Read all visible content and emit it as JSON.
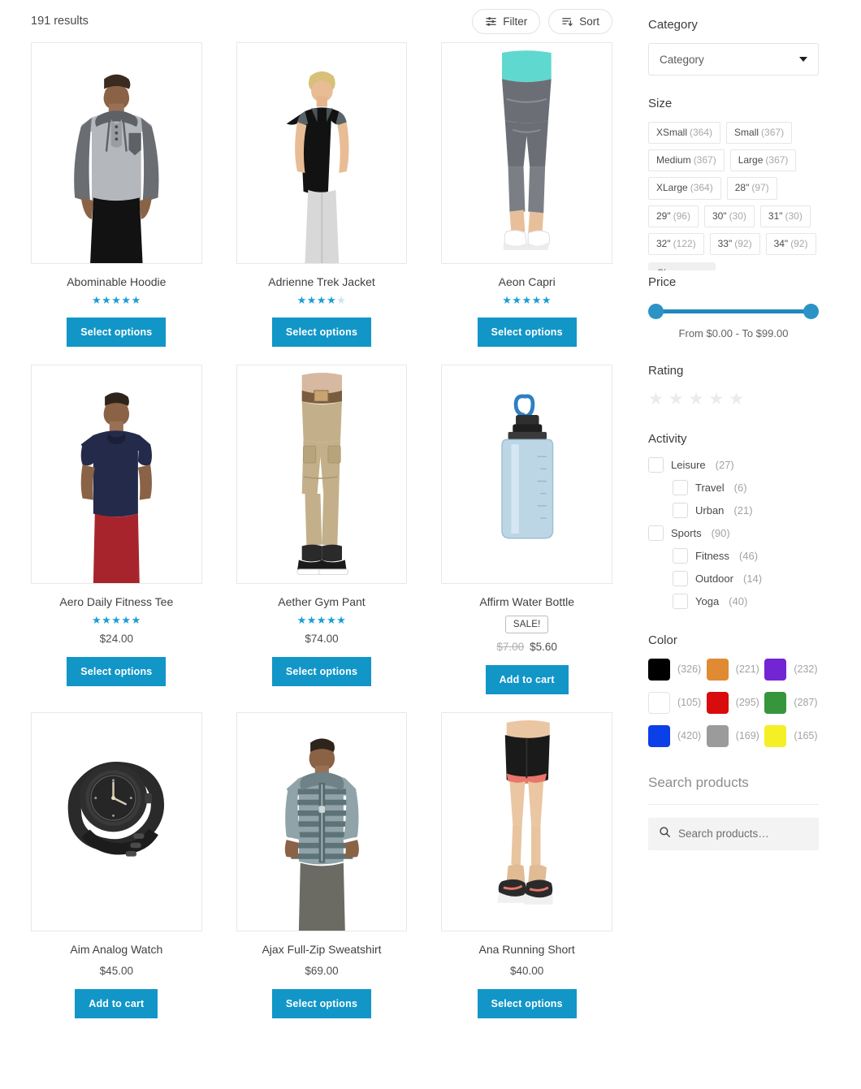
{
  "toolbar": {
    "results_count": "191 results",
    "filter_label": "Filter",
    "sort_label": "Sort",
    "filter_icon": "sliders-icon",
    "sort_icon": "sort-descending-icon"
  },
  "products": [
    {
      "title": "Abominable Hoodie",
      "rating": 5,
      "rating_max": 5,
      "price": "",
      "button": "Select options",
      "image": "mens-grey-hooded-henley-shirt"
    },
    {
      "title": "Adrienne Trek Jacket",
      "rating": 4,
      "rating_max": 5,
      "price": "",
      "button": "Select options",
      "image": "womens-black-tank-top"
    },
    {
      "title": "Aeon Capri",
      "rating": 5,
      "rating_max": 5,
      "price": "",
      "button": "Select options",
      "image": "womens-grey-capri-leggings"
    },
    {
      "title": "Aero Daily Fitness Tee",
      "rating": 5,
      "rating_max": 5,
      "price": "$24.00",
      "button": "Select options",
      "image": "mens-navy-tshirt"
    },
    {
      "title": "Aether Gym Pant",
      "rating": 5,
      "rating_max": 5,
      "price": "$74.00",
      "button": "Select options",
      "image": "mens-khaki-cargo-pants"
    },
    {
      "title": "Affirm Water Bottle",
      "rating": 0,
      "rating_max": 5,
      "badge": "SALE!",
      "price_original": "$7.00",
      "price": "$5.60",
      "button": "Add to cart",
      "image": "blue-water-bottle"
    },
    {
      "title": "Aim Analog Watch",
      "rating": 0,
      "rating_max": 5,
      "price": "$45.00",
      "button": "Add to cart",
      "image": "black-analog-watch"
    },
    {
      "title": "Ajax Full-Zip Sweatshirt",
      "rating": 0,
      "rating_max": 5,
      "price": "$69.00",
      "button": "Select options",
      "image": "mens-striped-zip-hoodie"
    },
    {
      "title": "Ana Running Short",
      "rating": 0,
      "rating_max": 5,
      "price": "$40.00",
      "button": "Select options",
      "image": "womens-black-running-shorts"
    }
  ],
  "sidebar": {
    "category": {
      "heading": "Category",
      "selected": "Category"
    },
    "size": {
      "heading": "Size",
      "show_more": "Show more",
      "options": [
        {
          "label": "XSmall",
          "count": "(364)"
        },
        {
          "label": "Small",
          "count": "(367)"
        },
        {
          "label": "Medium",
          "count": "(367)"
        },
        {
          "label": "Large",
          "count": "(367)"
        },
        {
          "label": "XLarge",
          "count": "(364)"
        },
        {
          "label": "28\"",
          "count": "(97)"
        },
        {
          "label": "29\"",
          "count": "(96)"
        },
        {
          "label": "30\"",
          "count": "(30)"
        },
        {
          "label": "31\"",
          "count": "(30)"
        },
        {
          "label": "32\"",
          "count": "(122)"
        },
        {
          "label": "33\"",
          "count": "(92)"
        },
        {
          "label": "34\"",
          "count": "(92)"
        }
      ]
    },
    "price": {
      "heading": "Price",
      "range_text": "From $0.00 - To $99.00",
      "min": "$0.00",
      "max": "$99.00",
      "track_color": "#2089bd"
    },
    "rating": {
      "heading": "Rating",
      "stars": 5,
      "filled": 0
    },
    "activity": {
      "heading": "Activity",
      "items": [
        {
          "label": "Leisure",
          "count": "(27)",
          "sub": false
        },
        {
          "label": "Travel",
          "count": "(6)",
          "sub": true
        },
        {
          "label": "Urban",
          "count": "(21)",
          "sub": true
        },
        {
          "label": "Sports",
          "count": "(90)",
          "sub": false
        },
        {
          "label": "Fitness",
          "count": "(46)",
          "sub": true
        },
        {
          "label": "Outdoor",
          "count": "(14)",
          "sub": true
        },
        {
          "label": "Yoga",
          "count": "(40)",
          "sub": true
        }
      ]
    },
    "color": {
      "heading": "Color",
      "items": [
        {
          "name": "black",
          "hex": "#000000",
          "count": "(326)"
        },
        {
          "name": "orange",
          "hex": "#e08a33",
          "count": "(221)"
        },
        {
          "name": "purple",
          "hex": "#7325d4",
          "count": "(232)"
        },
        {
          "name": "white",
          "hex": "#ffffff",
          "count": "(105)"
        },
        {
          "name": "red",
          "hex": "#d80c0c",
          "count": "(295)"
        },
        {
          "name": "green",
          "hex": "#37953c",
          "count": "(287)"
        },
        {
          "name": "blue",
          "hex": "#0b3fe8",
          "count": "(420)"
        },
        {
          "name": "grey",
          "hex": "#9b9b9b",
          "count": "(169)"
        },
        {
          "name": "yellow",
          "hex": "#f5ef26",
          "count": "(165)"
        }
      ]
    },
    "search": {
      "heading": "Search products",
      "placeholder": "Search products…",
      "value": "",
      "icon": "search-icon"
    }
  },
  "theme": {
    "accent": "#1196c7",
    "star": "#1a9ed4",
    "star_off": "#c9e6f4"
  }
}
